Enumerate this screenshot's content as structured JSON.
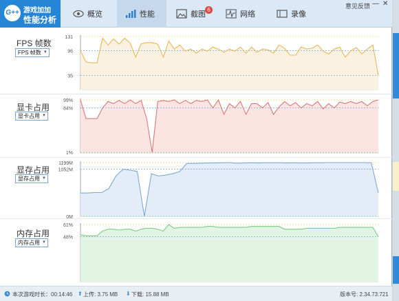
{
  "header": {
    "logo_line1": "游戏加加",
    "logo_line2": "性能分析",
    "logo_badge": "G++",
    "tabs": [
      {
        "label": "概览",
        "icon": "eye-icon"
      },
      {
        "label": "性能",
        "icon": "bar-chart-icon"
      },
      {
        "label": "截图",
        "icon": "image-icon"
      },
      {
        "label": "网络",
        "icon": "pulse-icon"
      },
      {
        "label": "录像",
        "icon": "video-icon"
      }
    ],
    "screenshot_badge": "6",
    "feedback_label": "意见反馈",
    "minimize_label": "—",
    "close_label": "✕"
  },
  "panels": {
    "fps": {
      "title": "FPS 帧数",
      "select": "FPS 帧数"
    },
    "gpu": {
      "title": "显卡占用",
      "select": "显卡占用"
    },
    "vram": {
      "title": "显存占用",
      "select": "显存占用"
    },
    "ram": {
      "title": "内存占用",
      "select": "内存占用"
    }
  },
  "status": {
    "session_label": "本次游戏时长：00:14:46",
    "upload_label": "上传: 3.75 MB",
    "download_label": "下载: 15.88 MB",
    "version_label": "版本号: 2.34.73.721"
  },
  "chart_data": [
    {
      "type": "line",
      "name": "FPS",
      "color": "#e8b85a",
      "fill": "#fbf1e0",
      "yticks": [
        {
          "v": 131,
          "label": "131"
        },
        {
          "v": 96,
          "label": "96"
        },
        {
          "v": 35,
          "label": "35"
        }
      ],
      "ylim": [
        0,
        131
      ],
      "values": [
        96,
        68,
        66,
        66,
        127,
        110,
        125,
        112,
        127,
        115,
        80,
        113,
        116,
        116,
        112,
        80,
        120,
        100,
        110,
        95,
        100,
        90,
        100,
        95,
        105,
        100,
        92,
        100,
        95,
        105,
        90,
        105,
        92,
        100,
        98,
        90,
        110,
        102,
        85,
        85,
        105,
        100,
        102,
        110,
        95,
        88,
        100,
        105,
        80,
        96,
        104,
        88,
        100,
        110,
        35
      ]
    },
    {
      "type": "line",
      "name": "GPU",
      "color": "#d9787a",
      "fill": "#fbe4e2",
      "yticks": [
        {
          "v": 99,
          "label": "99%"
        },
        {
          "v": 84,
          "label": "84%"
        },
        {
          "v": 1,
          "label": "1%"
        }
      ],
      "ylim": [
        0,
        99
      ],
      "values": [
        99,
        64,
        64,
        64,
        84,
        96,
        92,
        98,
        92,
        99,
        92,
        98,
        64,
        1,
        96,
        98,
        96,
        99,
        92,
        98,
        92,
        98,
        96,
        99,
        84,
        99,
        72,
        92,
        84,
        96,
        72,
        92,
        92,
        84,
        94,
        72,
        86,
        96,
        88,
        94,
        84,
        92,
        88,
        96,
        82,
        92,
        84,
        95,
        92,
        96,
        92,
        96,
        88,
        96,
        99
      ]
    },
    {
      "type": "line",
      "name": "VRAM",
      "color": "#7fa8d6",
      "fill": "#e4edf7",
      "yticks": [
        {
          "v": 1199,
          "label": "1199M"
        },
        {
          "v": 1052,
          "label": "1052M"
        },
        {
          "v": 0,
          "label": "0M"
        }
      ],
      "ylim": [
        0,
        1199
      ],
      "values": [
        520,
        520,
        530,
        530,
        620,
        900,
        1050,
        1030,
        1000,
        0,
        950,
        900,
        920,
        950,
        1000,
        1180,
        1180,
        1185,
        1190,
        1190,
        1195,
        1199,
        1185,
        1190,
        1195,
        1190,
        1195,
        1195,
        1195,
        1190,
        1195,
        1190,
        1190,
        1195,
        1195,
        1199,
        1199,
        1199,
        1199,
        1199,
        1199,
        1195,
        520
      ]
    },
    {
      "type": "line",
      "name": "RAM",
      "color": "#7ccc84",
      "fill": "#e2f4e4",
      "yticks": [
        {
          "v": 61,
          "label": "61%"
        },
        {
          "v": 48,
          "label": "48%"
        }
      ],
      "ylim": [
        0,
        61
      ],
      "values": [
        50,
        49,
        49,
        49,
        54,
        56,
        56,
        55,
        56,
        56,
        54,
        56,
        57,
        57,
        56,
        54,
        61,
        57,
        58,
        58,
        58,
        58,
        58,
        59,
        59,
        58,
        58,
        58,
        58,
        58,
        58,
        59,
        59,
        59,
        59,
        59,
        59,
        56,
        56,
        56,
        56,
        57,
        57,
        57,
        57,
        57,
        57,
        58,
        58,
        58,
        58,
        58,
        58,
        58,
        48
      ]
    }
  ]
}
